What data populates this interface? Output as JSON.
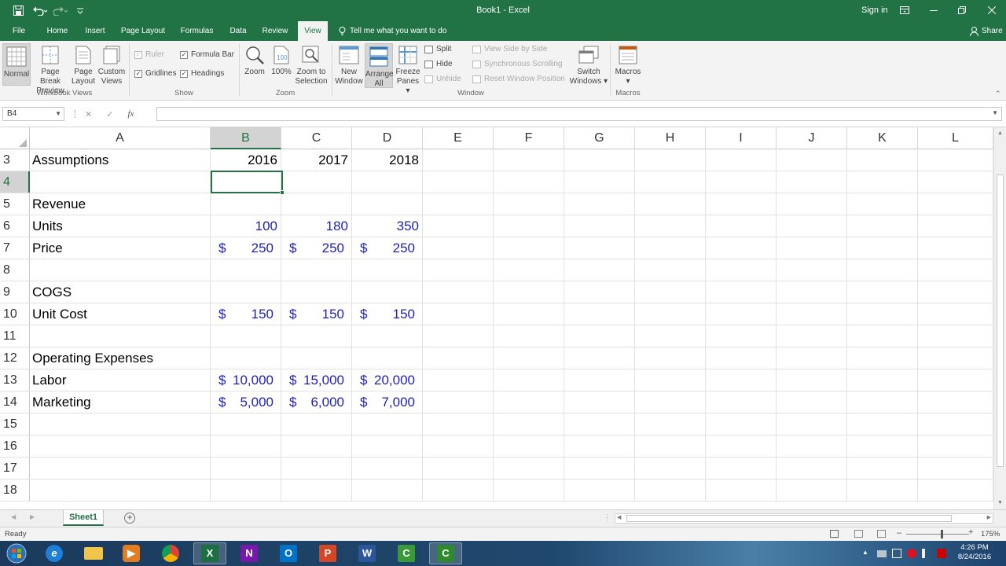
{
  "titlebar": {
    "title": "Book1 - Excel",
    "signin": "Sign in"
  },
  "tabs": [
    "File",
    "Home",
    "Insert",
    "Page Layout",
    "Formulas",
    "Data",
    "Review",
    "View"
  ],
  "active_tab": "View",
  "tellme": "Tell me what you want to do",
  "share": "Share",
  "ribbon": {
    "workbook_views": {
      "label": "Workbook Views",
      "normal": "Normal",
      "page_break_1": "Page Break",
      "page_break_2": "Preview",
      "page_layout_1": "Page",
      "page_layout_2": "Layout",
      "custom_views_1": "Custom",
      "custom_views_2": "Views"
    },
    "show": {
      "label": "Show",
      "ruler": "Ruler",
      "formula_bar": "Formula Bar",
      "gridlines": "Gridlines",
      "headings": "Headings"
    },
    "zoom": {
      "label": "Zoom",
      "zoom": "Zoom",
      "hundred": "100%",
      "zoom_sel_1": "Zoom to",
      "zoom_sel_2": "Selection"
    },
    "window": {
      "label": "Window",
      "new_window_1": "New",
      "new_window_2": "Window",
      "arrange_1": "Arrange",
      "arrange_2": "All",
      "freeze_1": "Freeze",
      "freeze_2": "Panes",
      "split": "Split",
      "hide": "Hide",
      "unhide": "Unhide",
      "side_by_side": "View Side by Side",
      "sync_scroll": "Synchronous Scrolling",
      "reset_pos": "Reset Window Position",
      "switch_1": "Switch",
      "switch_2": "Windows"
    },
    "macros": {
      "label": "Macros",
      "macros": "Macros"
    }
  },
  "formula_bar": {
    "name_box": "B4",
    "fx": "fx",
    "formula": ""
  },
  "columns": [
    "A",
    "B",
    "C",
    "D",
    "E",
    "F",
    "G",
    "H",
    "I",
    "J",
    "K",
    "L"
  ],
  "selected_column": "B",
  "selected_row": "4",
  "rows": [
    {
      "n": "3",
      "a": "Assumptions",
      "b": "2016",
      "c": "2017",
      "d": "2018",
      "kind": "year"
    },
    {
      "n": "4",
      "a": "",
      "kind": "blank"
    },
    {
      "n": "5",
      "a": "Revenue",
      "kind": "blank"
    },
    {
      "n": "6",
      "a": "Units",
      "b": "100",
      "c": "180",
      "d": "350",
      "kind": "num"
    },
    {
      "n": "7",
      "a": "Price",
      "b": "250",
      "c": "250",
      "d": "250",
      "kind": "cur"
    },
    {
      "n": "8",
      "a": "",
      "kind": "blank"
    },
    {
      "n": "9",
      "a": "COGS",
      "kind": "blank"
    },
    {
      "n": "10",
      "a": "Unit Cost",
      "b": "150",
      "c": "150",
      "d": "150",
      "kind": "cur"
    },
    {
      "n": "11",
      "a": "",
      "kind": "blank"
    },
    {
      "n": "12",
      "a": "Operating Expenses",
      "kind": "blank"
    },
    {
      "n": "13",
      "a": "Labor",
      "b": "10,000",
      "c": "15,000",
      "d": "20,000",
      "kind": "curwide"
    },
    {
      "n": "14",
      "a": "Marketing",
      "b": "5,000",
      "c": "6,000",
      "d": "7,000",
      "kind": "cur"
    },
    {
      "n": "15",
      "a": "",
      "kind": "blank"
    },
    {
      "n": "16",
      "a": "",
      "kind": "blank"
    },
    {
      "n": "17",
      "a": "",
      "kind": "blank"
    },
    {
      "n": "18",
      "a": "",
      "kind": "blank"
    }
  ],
  "currency_symbol": "$",
  "sheet": {
    "name": "Sheet1"
  },
  "status": {
    "text": "Ready",
    "zoom": "175%"
  },
  "taskbar": {
    "time": "4:26 PM",
    "date": "8/24/2016"
  },
  "colors": {
    "excel_green": "#217346",
    "input_blue": "#1f1fb4"
  }
}
